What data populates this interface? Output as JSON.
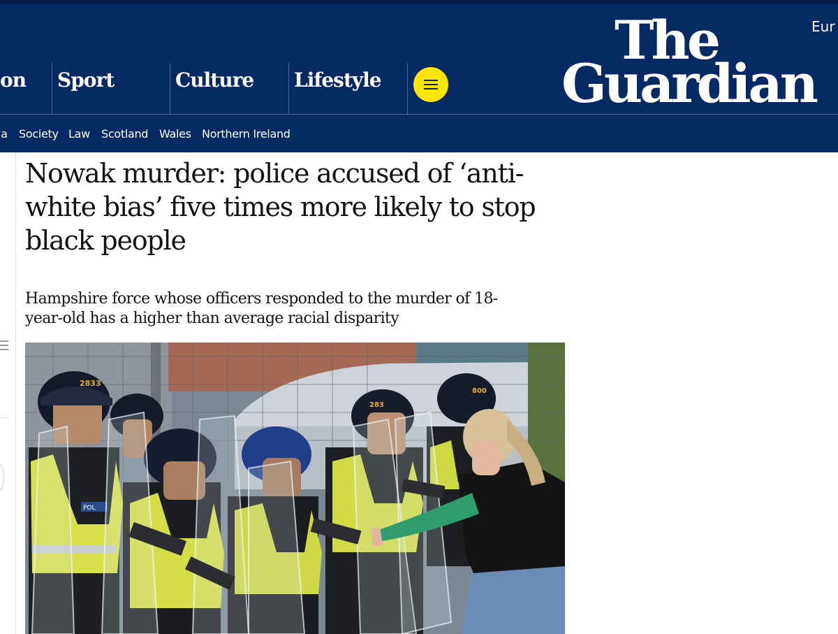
{
  "masthead": {
    "edition_label": "Eur",
    "logo_line1": "The",
    "logo_line2": "Guardian",
    "pillars": [
      {
        "label": "on"
      },
      {
        "label": "Sport"
      },
      {
        "label": "Culture"
      },
      {
        "label": "Lifestyle"
      }
    ],
    "menu_button_color": "#ffe500",
    "brand_color": "#052962"
  },
  "subnav": {
    "items": [
      "ia",
      "Society",
      "Law",
      "Scotland",
      "Wales",
      "Northern Ireland"
    ]
  },
  "article": {
    "headline": "Nowak murder: police accused of ‘anti-white bias’ five times more likely to stop black people",
    "standfirst": "Hampshire force whose officers responded to the murder of 18-year-old has a higher than average racial disparity",
    "photo_text": {
      "helmet_numbers": [
        "2833",
        "283",
        "800"
      ],
      "badge": "POL"
    }
  },
  "icons": {
    "menu": "hamburger-icon",
    "left_rail": "list-icon"
  }
}
